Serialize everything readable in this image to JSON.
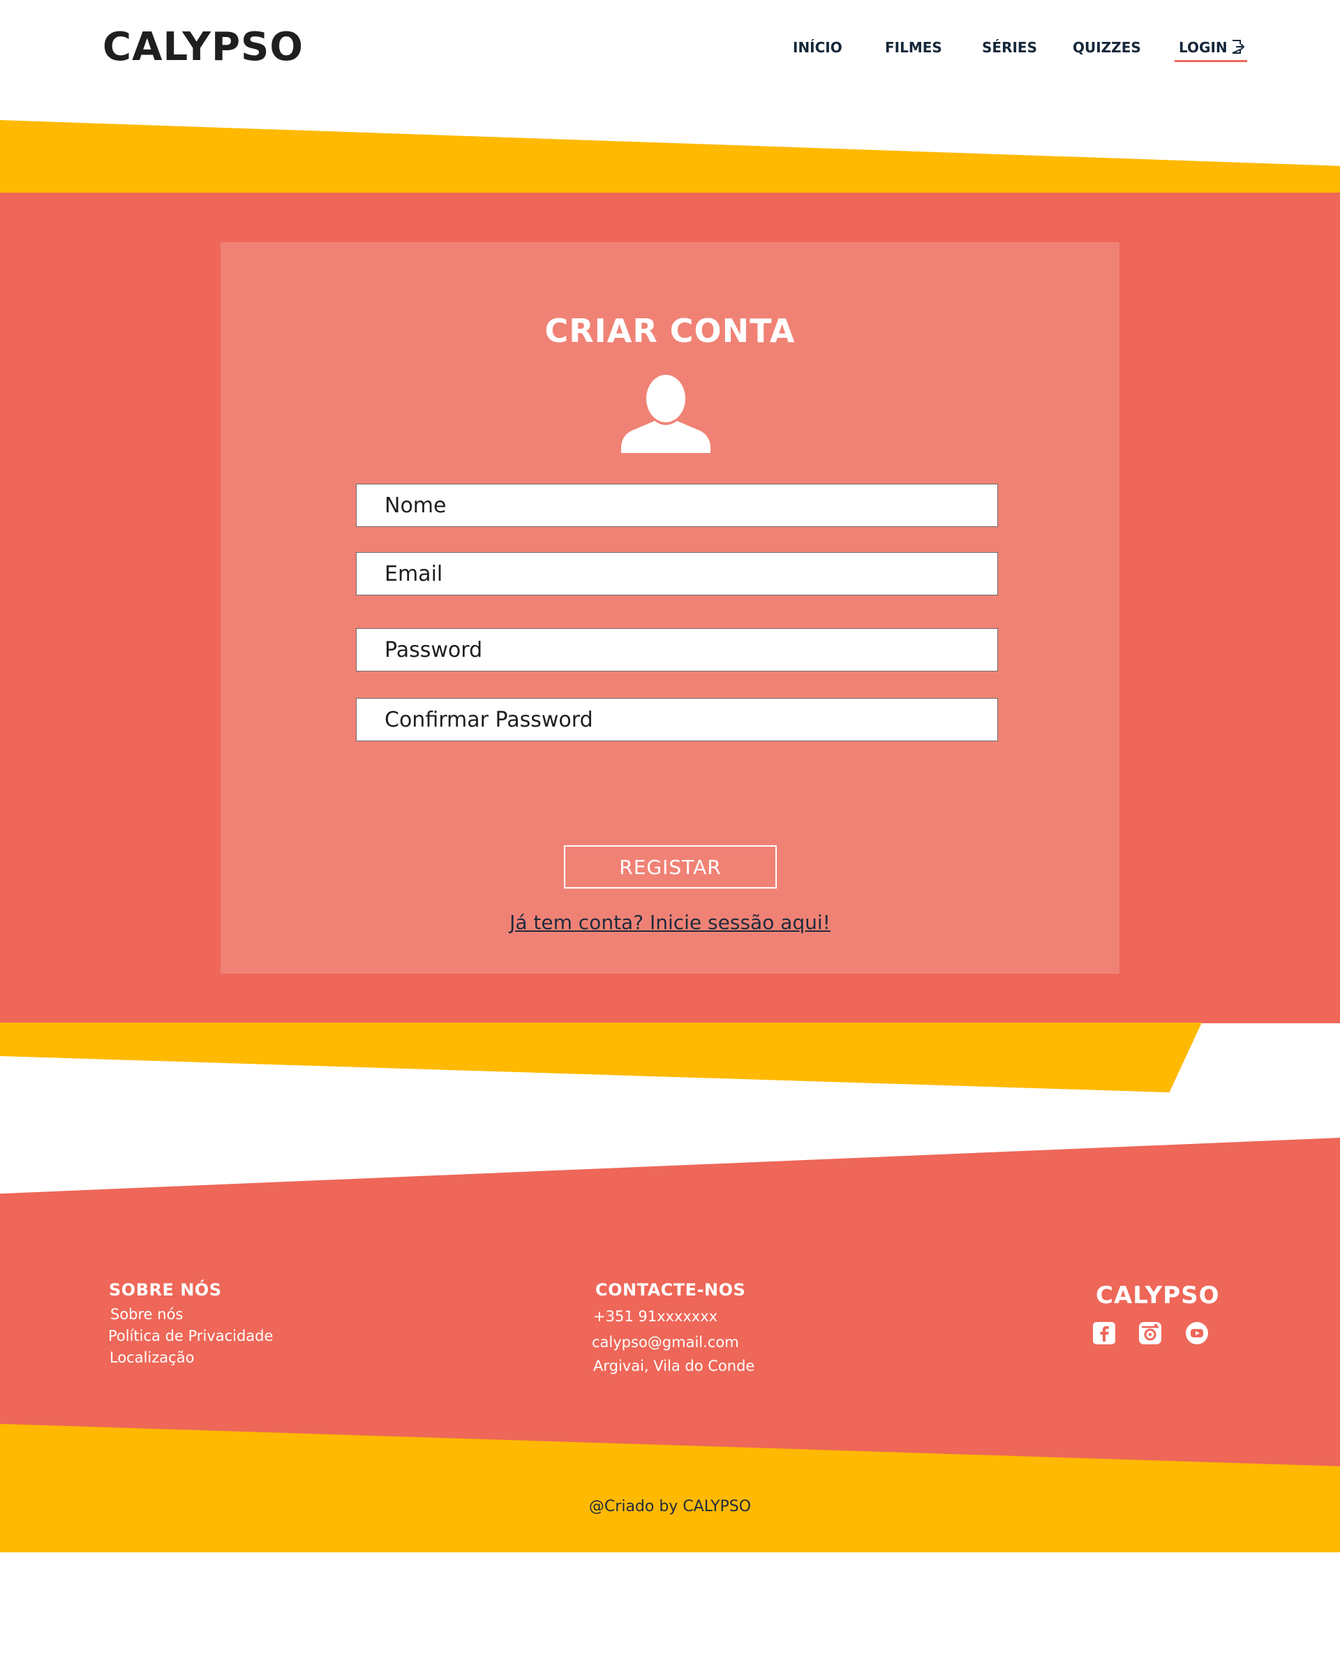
{
  "header": {
    "logo": "CALYPSO",
    "nav": [
      {
        "label": "INÍCIO"
      },
      {
        "label": "FILMES"
      },
      {
        "label": "SÉRIES"
      },
      {
        "label": "QUIZZES"
      },
      {
        "label": "LOGIN"
      }
    ]
  },
  "form": {
    "title": "CRIAR CONTA",
    "fields": {
      "name": {
        "placeholder": "Nome",
        "value": ""
      },
      "email": {
        "placeholder": "Email",
        "value": ""
      },
      "password": {
        "placeholder": "Password",
        "value": ""
      },
      "confirm": {
        "placeholder": "Confirmar Password",
        "value": ""
      }
    },
    "submit_label": "REGISTAR",
    "login_link": "Já tem conta? Inicie sessão aqui!"
  },
  "footer": {
    "about": {
      "heading": "SOBRE NÓS",
      "links": [
        "Sobre nós",
        "Política de Privacidade",
        "Localização"
      ]
    },
    "contact": {
      "heading": "CONTACTE-NOS",
      "phone": "+351 91xxxxxxx",
      "email": "calypso@gmail.com",
      "address": "Argivai, Vila do Conde"
    },
    "brand": "CALYPSO",
    "social_icons": [
      "facebook-icon",
      "instagram-icon",
      "youtube-icon"
    ],
    "copyright": "@Criado by CALYPSO"
  },
  "colors": {
    "coral": "#ee6758",
    "coral_light": "#f08275",
    "yellow": "#ffb900",
    "dark": "#1f1f1f"
  }
}
